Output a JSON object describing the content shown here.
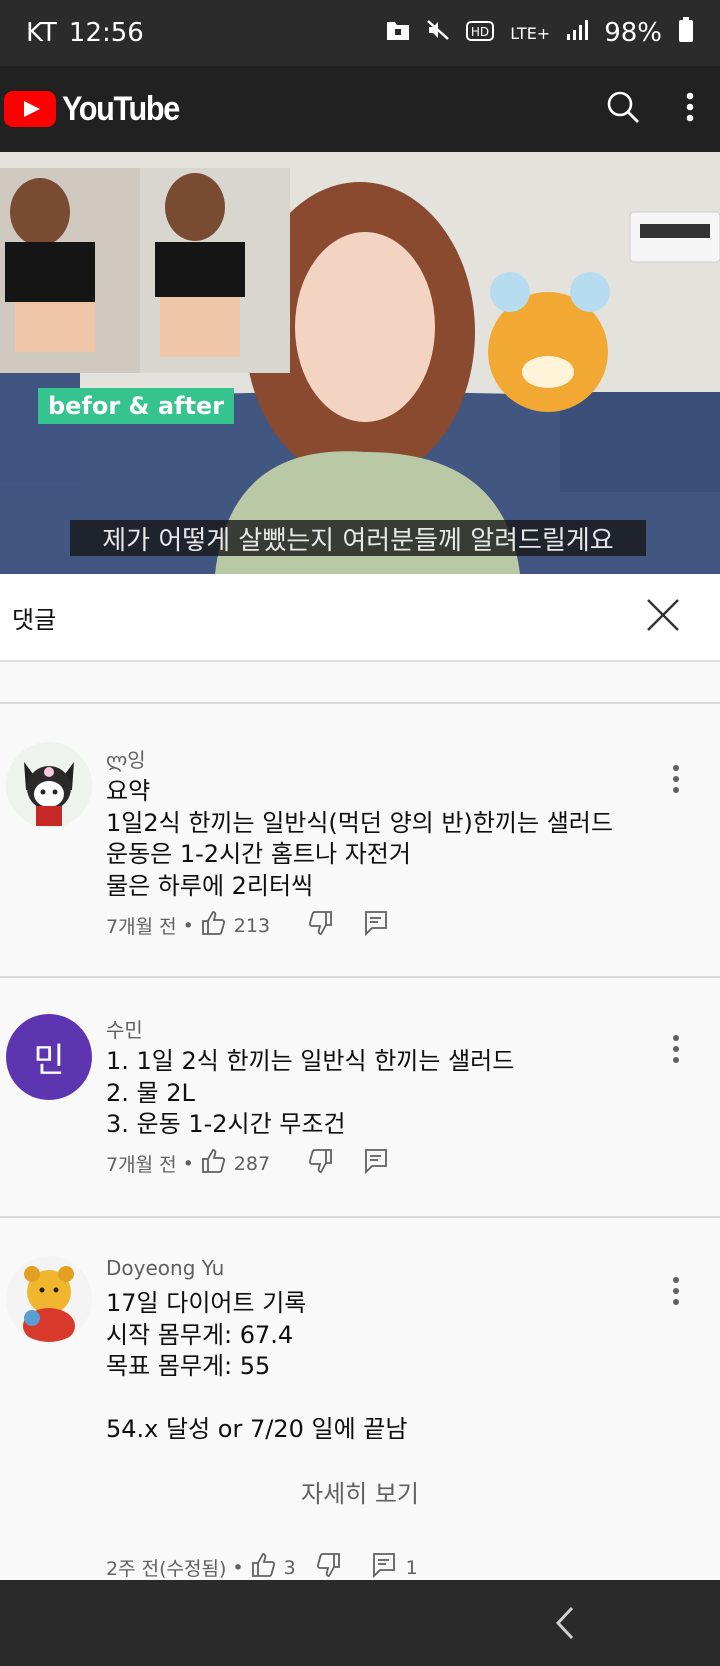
{
  "status_bar": {
    "carrier": "KT",
    "time": "12:56",
    "network": "LTE+",
    "battery": "98%"
  },
  "app_bar": {
    "logo_text": "YouTube",
    "icons": [
      "search-icon",
      "more-vert-icon"
    ]
  },
  "video": {
    "overlay_badge": "befor & after",
    "subtitle": "제가 어떻게 살뺐는지 여러분들께 알려드릴게요"
  },
  "comments_panel": {
    "title": "댓글",
    "close_icon": "close-icon"
  },
  "comments": [
    {
      "author": "ლ잉",
      "text": "요약\n1일2식 한끼는 일반식(먹던 양의 반)한끼는 샐러드\n운동은 1-2시간 홈트나 자전거\n물은 하루에 2리터씩",
      "time": "7개월 전",
      "likes": "213",
      "replies": ""
    },
    {
      "author": "수민",
      "avatar_letter": "민",
      "avatar_color": "#5e35b1",
      "text": "1. 1일 2식 한끼는 일반식 한끼는 샐러드\n2. 물 2L\n3. 운동 1-2시간 무조건",
      "time": "7개월 전",
      "likes": "287",
      "replies": ""
    },
    {
      "author": "Doyeong Yu",
      "text": "17일 다이어트 기록\n시작 몸무게: 67.4\n목표 몸무게: 55\n\n54.x 달성 or 7/20 일에 끝남",
      "more_label": "자세히 보기",
      "time": "2주 전(수정됨)",
      "likes": "3",
      "replies": "1"
    }
  ]
}
